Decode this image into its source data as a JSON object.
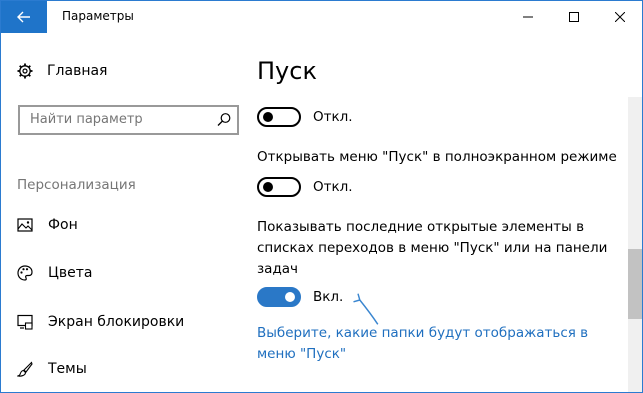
{
  "window": {
    "title": "Параметры"
  },
  "sidebar": {
    "home_label": "Главная",
    "search_placeholder": "Найти параметр",
    "section_label": "Персонализация",
    "items": [
      {
        "label": "Фон",
        "icon": "picture-icon"
      },
      {
        "label": "Цвета",
        "icon": "palette-icon"
      },
      {
        "label": "Экран блокировки",
        "icon": "lock-screen-icon"
      },
      {
        "label": "Темы",
        "icon": "brush-icon"
      }
    ]
  },
  "main": {
    "title": "Пуск",
    "settings": [
      {
        "description": "",
        "state_label": "Откл.",
        "on": false
      },
      {
        "description": "Открывать меню \"Пуск\" в полноэкранном режиме",
        "state_label": "Откл.",
        "on": false
      },
      {
        "description": "Показывать последние открытые элементы в списках переходов в меню \"Пуск\" или на панели задач",
        "state_label": "Вкл.",
        "on": true
      }
    ],
    "link_text": "Выберите, какие папки будут отображаться в меню \"Пуск\""
  },
  "colors": {
    "accent": "#2a78c7",
    "link": "#1f6fbf",
    "annotation_arrow": "#3a86d0"
  }
}
